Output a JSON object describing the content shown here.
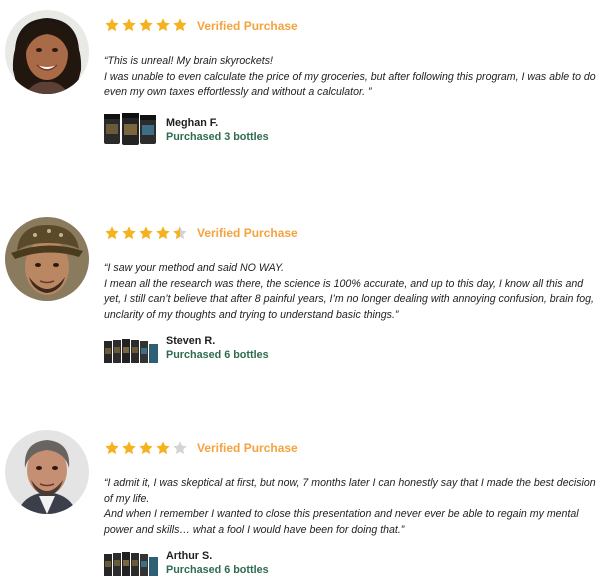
{
  "reviews": [
    {
      "rating": 5,
      "verified_label": "Verified Purchase",
      "quote_lines": [
        "“This is unreal! My brain skyrockets!",
        "I was unable to even calculate the price of my groceries, but after following this program, I was able to do even my own taxes effortlessly and without a calculator. ”"
      ],
      "name": "Meghan F.",
      "purchase": "Purchased 3 bottles",
      "bottle_count": 3
    },
    {
      "rating": 4.5,
      "verified_label": "Verified Purchase",
      "quote_lines": [
        "“I saw your method and said NO WAY.",
        "I mean all the research was there, the science is 100% accurate, and up to this day, I know all this and yet, I still can’t believe that after 8 painful years, I’m no longer dealing with annoying confusion, brain fog, unclarity of my thoughts and trying to understand basic things.”"
      ],
      "name": "Steven R.",
      "purchase": "Purchased 6 bottles",
      "bottle_count": 6
    },
    {
      "rating": 4,
      "verified_label": "Verified Purchase",
      "quote_lines": [
        "“I admit it, I was skeptical at first, but now, 7 months later I can honestly say that I made the best decision of my life.",
        "And when I remember I wanted to close this presentation and never ever be able to regain my mental power and skills… what a fool I would have been for doing that.”"
      ],
      "name": "Arthur S.",
      "purchase": "Purchased 6 bottles",
      "bottle_count": 6
    }
  ],
  "colors": {
    "star_fill": "#f5b21f",
    "star_empty": "#d4d4d4",
    "verified": "#f4a340",
    "purchase": "#2e6b4f"
  }
}
